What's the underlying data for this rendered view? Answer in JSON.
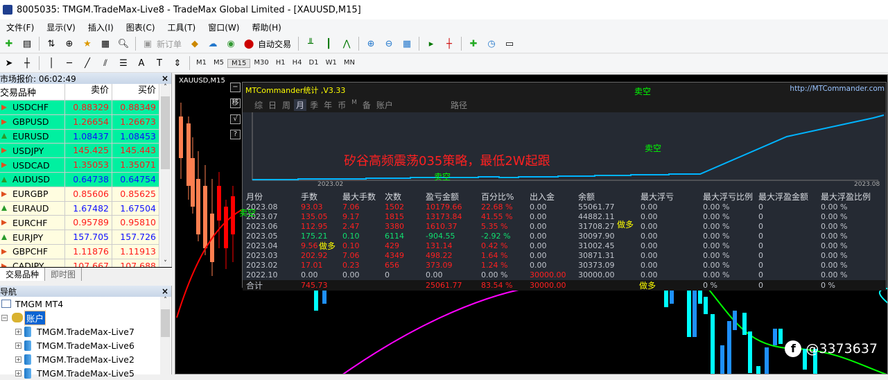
{
  "window": {
    "title": "8005035: TMGM.TradeMax-Live8 - TradeMax Global Limited - [XAUUSD,M15]"
  },
  "menu": [
    "文件(F)",
    "显示(V)",
    "插入(I)",
    "图表(C)",
    "工具(T)",
    "窗口(W)",
    "帮助(H)"
  ],
  "toolbar": {
    "new_order": "新订单",
    "auto_trading": "自动交易",
    "timeframes": [
      "M1",
      "M5",
      "M15",
      "M30",
      "H1",
      "H4",
      "D1",
      "W1",
      "MN"
    ],
    "active_timeframe": "M15"
  },
  "market_watch": {
    "title": "市场报价: 06:02:49",
    "columns": [
      "交易品种",
      "卖价",
      "买价"
    ],
    "rows": [
      {
        "symbol": "USDCHF",
        "bid": "0.88329",
        "ask": "0.88349",
        "dir": "down",
        "hl": true
      },
      {
        "symbol": "GBPUSD",
        "bid": "1.26654",
        "ask": "1.26673",
        "dir": "down",
        "hl": true
      },
      {
        "symbol": "EURUSD",
        "bid": "1.08437",
        "ask": "1.08453",
        "dir": "up",
        "hl": true
      },
      {
        "symbol": "USDJPY",
        "bid": "145.425",
        "ask": "145.443",
        "dir": "down",
        "hl": true
      },
      {
        "symbol": "USDCAD",
        "bid": "1.35053",
        "ask": "1.35071",
        "dir": "down",
        "hl": true
      },
      {
        "symbol": "AUDUSD",
        "bid": "0.64738",
        "ask": "0.64754",
        "dir": "up",
        "hl": true
      },
      {
        "symbol": "EURGBP",
        "bid": "0.85606",
        "ask": "0.85625",
        "dir": "down",
        "hl": false
      },
      {
        "symbol": "EURAUD",
        "bid": "1.67482",
        "ask": "1.67504",
        "dir": "up",
        "hl": false
      },
      {
        "symbol": "EURCHF",
        "bid": "0.95789",
        "ask": "0.95810",
        "dir": "down",
        "hl": false
      },
      {
        "symbol": "EURJPY",
        "bid": "157.705",
        "ask": "157.726",
        "dir": "up",
        "hl": false
      },
      {
        "symbol": "GBPCHF",
        "bid": "1.11876",
        "ask": "1.11913",
        "dir": "down",
        "hl": false
      },
      {
        "symbol": "CADJPY",
        "bid": "107.667",
        "ask": "107.688",
        "dir": "down",
        "hl": false
      }
    ],
    "tabs": [
      "交易品种",
      "即时图"
    ]
  },
  "navigator": {
    "title": "导航",
    "root": "TMGM MT4",
    "accounts": "账户",
    "servers": [
      "TMGM.TradeMax-Live7",
      "TMGM.TradeMax-Live6",
      "TMGM.TradeMax-Live2",
      "TMGM.TradeMax-Live5"
    ]
  },
  "chart": {
    "symbol": "XAUUSD,M15",
    "side_buttons": [
      "−",
      "移",
      "√",
      "?"
    ],
    "watermark": "@3373637",
    "panel": {
      "title": "MTCommander统计 ,V3.33",
      "url": "http://MTCommander.com",
      "tabs": [
        "综",
        "日",
        "周",
        "月",
        "季",
        "年",
        "币",
        "M",
        "备",
        "账户",
        "路径"
      ],
      "active_tab": "月",
      "strategy_text": "矽谷高频震荡035策略，最低2W起跟",
      "signal_sell": "卖空",
      "signal_buy": "做多",
      "x_start": "2023.02",
      "x_end": "2023.08",
      "columns": [
        "月份",
        "手数",
        "最大手数",
        "次数",
        "盈亏金额",
        "百分比%",
        "出入金",
        "余额",
        "最大浮亏",
        "最大浮亏比例",
        "最大浮盈金额",
        "最大浮盈比例"
      ],
      "rows": [
        [
          "2023.08",
          "93.03",
          "7.06",
          "1502",
          "10179.66",
          "22.68 %",
          "0.00",
          "55061.77",
          "0.00",
          "0.00 %",
          "0",
          "0.00 %"
        ],
        [
          "2023.07",
          "135.05",
          "9.17",
          "1815",
          "13173.84",
          "41.55 %",
          "0.00",
          "44882.11",
          "0.00",
          "0.00 %",
          "0",
          "0.00 %"
        ],
        [
          "2023.06",
          "112.95",
          "2.47",
          "3380",
          "1610.37",
          "5.35 %",
          "0.00",
          "31708.27",
          "0.00",
          "0.00 %",
          "0",
          "0.00 %"
        ],
        [
          "2023.05",
          "175.21",
          "0.10",
          "6114",
          "-904.55",
          "-2.92 %",
          "0.00",
          "30097.90",
          "0.00",
          "0.00 %",
          "0",
          "0.00 %"
        ],
        [
          "2023.04",
          "9.56",
          "0.10",
          "429",
          "131.14",
          "0.42 %",
          "0.00",
          "31002.45",
          "0.00",
          "0.00 %",
          "0",
          "0.00 %"
        ],
        [
          "2023.03",
          "202.92",
          "7.06",
          "4349",
          "498.22",
          "1.64 %",
          "0.00",
          "30871.31",
          "0.00",
          "0.00 %",
          "0",
          "0.00 %"
        ],
        [
          "2023.02",
          "17.01",
          "0.23",
          "656",
          "373.09",
          "1.24 %",
          "0.00",
          "30373.09",
          "0.00",
          "0.00 %",
          "0",
          "0.00 %"
        ],
        [
          "2022.10",
          "0.00",
          "0.00",
          "0",
          "0.00",
          "0.00 %",
          "30000.00",
          "30000.00",
          "0.00",
          "0.00 %",
          "0",
          "0.00 %"
        ]
      ],
      "total": {
        "label": "合计",
        "lots": "745.73",
        "pnl": "25061.77",
        "pct": "83.54 %",
        "deposit": "30000.00",
        "max_dd_pct": "0 %",
        "max_fp": "0",
        "max_fp_pct": "0 %"
      }
    }
  },
  "colors": {
    "profit": "#ff2020",
    "loss": "#10e070",
    "equity": "#00b4ff",
    "highlight_row": "#00f0a0"
  }
}
